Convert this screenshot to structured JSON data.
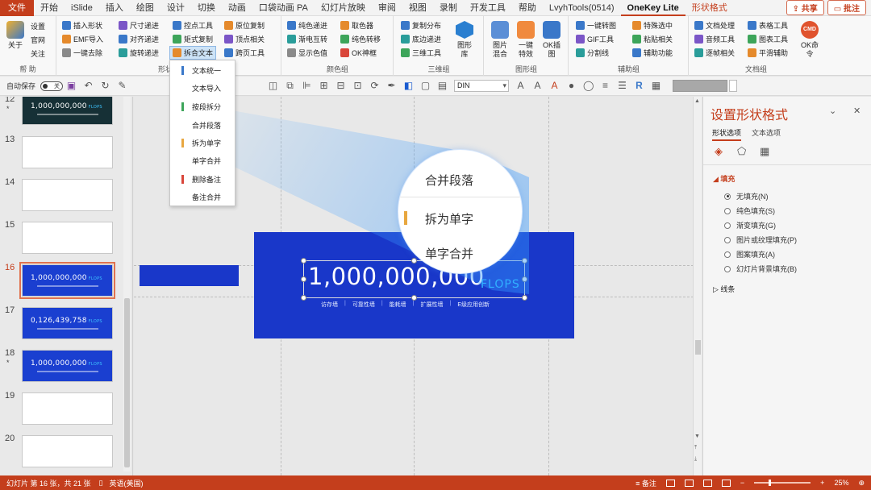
{
  "menubar": {
    "file": "文件",
    "tabs": [
      "开始",
      "iSlide",
      "插入",
      "绘图",
      "设计",
      "切换",
      "动画",
      "口袋动画 PA",
      "幻灯片放映",
      "审阅",
      "视图",
      "录制",
      "开发工具",
      "帮助",
      "LvyhTools(0514)",
      "OneKey Lite",
      "形状格式"
    ],
    "share": "共享",
    "comment": "批注"
  },
  "ribbon": {
    "help_group": {
      "about": "关于",
      "settings": "设置",
      "website": "官网",
      "follow": "关注",
      "label": "帮 助"
    },
    "shape_group": {
      "insert_shape": "插入形状",
      "size_compare": "尺寸递进",
      "emf_import": "EMF导入",
      "align_compare": "对齐递进",
      "one_click_remove": "一键去除",
      "rotate_compare": "旋转递进",
      "control_tool": "控点工具",
      "matrix_copy": "矩式复制",
      "split_text": "拆合文本",
      "origin_copy": "原位复制",
      "vertex_related": "顶点相关",
      "cross_page": "跨页工具",
      "label": "形状组"
    },
    "color_group": {
      "pure_compare": "纯色递进",
      "gradient_swap": "渐电互转",
      "show_color": "显示色值",
      "picker": "取色器",
      "pure_shift": "纯色转移",
      "ok_frame": "OK神框",
      "label": "颜色组"
    },
    "3d_group": {
      "copy_dist": "复制分布",
      "base_compare": "底边递进",
      "3d_tool": "三维工具",
      "shape_lib": "图形库",
      "label": "三维组"
    },
    "image_group": {
      "img_mix": "图片混合",
      "one_effect": "一键特效",
      "ok_img": "OK插图",
      "label": "图形组"
    },
    "aux_group": {
      "one_convert": "一键转图",
      "gif_tool": "GIF工具",
      "split_line": "分割线",
      "special_select": "特殊选中",
      "paste_related": "粘贴相关",
      "aux_func": "辅助功能",
      "label": "辅助组"
    },
    "doc_group": {
      "doc_process": "文档处理",
      "audio_tool": "音频工具",
      "page_related": "逐帧相关",
      "table_tool": "表格工具",
      "chart_tool": "图表工具",
      "smooth_aux": "平滑辅助",
      "ok_cmd": "OK命令",
      "label": "文档组"
    }
  },
  "dropdown": {
    "items": [
      {
        "label": "文本统一",
        "bar": "#3a78c9"
      },
      {
        "label": "文本导入",
        "bar": ""
      },
      {
        "label": "按段拆分",
        "bar": "#3da55a"
      },
      {
        "label": "合并段落",
        "bar": ""
      },
      {
        "label": "拆为单字",
        "bar": "#e8a740"
      },
      {
        "label": "单字合并",
        "bar": ""
      },
      {
        "label": "删除备注",
        "bar": "#d9463a"
      },
      {
        "label": "备注合并",
        "bar": ""
      }
    ]
  },
  "toolbar2": {
    "autosave": "自动保存",
    "toggle": "关",
    "font": "DIN"
  },
  "thumbnails": [
    {
      "num": "12",
      "star": "*",
      "style": "dark",
      "text": "1,000,000,000",
      "sub": "FLOPS"
    },
    {
      "num": "13",
      "star": "",
      "style": "white",
      "text": "",
      "sub": ""
    },
    {
      "num": "14",
      "star": "",
      "style": "white",
      "text": "",
      "sub": ""
    },
    {
      "num": "15",
      "star": "",
      "style": "white",
      "text": "",
      "sub": ""
    },
    {
      "num": "16",
      "star": "",
      "style": "blue",
      "text": "1,000,000,000",
      "sub": "FLOPS"
    },
    {
      "num": "17",
      "star": "",
      "style": "blue",
      "text": "0,126,439,758",
      "sub": "FLOPS"
    },
    {
      "num": "18",
      "star": "*",
      "style": "blue",
      "text": "1,000,000,000",
      "sub": "FLOPS"
    },
    {
      "num": "19",
      "star": "",
      "style": "white",
      "text": "",
      "sub": ""
    },
    {
      "num": "20",
      "star": "",
      "style": "white",
      "text": "",
      "sub": ""
    }
  ],
  "slide": {
    "number": "1,000,000,000",
    "unit": "FLOPS",
    "subtitle": [
      "访存墙",
      "可靠性墙",
      "能耗墙",
      "扩展性墙",
      "E级应用创新"
    ]
  },
  "lens": {
    "l1": "合并段落",
    "l2": "拆为单字",
    "l3": "单字合并"
  },
  "pane": {
    "title": "设置形状格式",
    "tab_shape": "形状选项",
    "tab_text": "文本选项",
    "fill_header": "填充",
    "fill_options": [
      "无填充(N)",
      "纯色填充(S)",
      "渐变填充(G)",
      "图片或纹理填充(P)",
      "图案填充(A)",
      "幻灯片背景填充(B)"
    ],
    "line_header": "线条"
  },
  "status": {
    "slide_info": "幻灯片 第 16 张，共 21 张",
    "lang": "英语(美国)",
    "notes": "备注",
    "zoom": "25%"
  }
}
